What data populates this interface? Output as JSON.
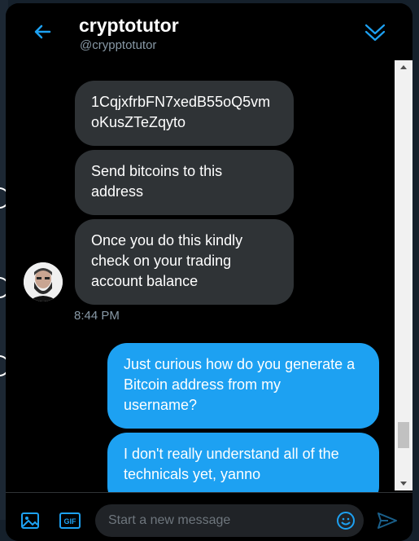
{
  "header": {
    "title": "cryptotutor",
    "handle": "@crypptotutor"
  },
  "messages": [
    {
      "direction": "in",
      "text": "1CqjxfrbFN7xedB55oQ5vm\noKusZTeZqyto"
    },
    {
      "direction": "in",
      "text": "Send bitcoins to this\naddress"
    },
    {
      "direction": "in",
      "text": "Once you do this kindly\ncheck on your trading\naccount balance"
    },
    {
      "direction": "out",
      "text": "Just curious how do you generate a\nBitcoin address from my\nusername?"
    },
    {
      "direction": "out",
      "text": "I don't really understand all of the\ntechnicals yet, yanno"
    }
  ],
  "timestamp": "8:44 PM",
  "composer": {
    "placeholder": "Start a new message",
    "gif_label": "GIF"
  },
  "colors": {
    "accent": "#1da1f2",
    "incoming_bubble": "#2f3336",
    "window_bg": "#000000"
  },
  "icons": [
    "back-arrow-icon",
    "collapse-chevron-icon",
    "image-icon",
    "gif-icon",
    "emoji-icon",
    "send-icon"
  ]
}
